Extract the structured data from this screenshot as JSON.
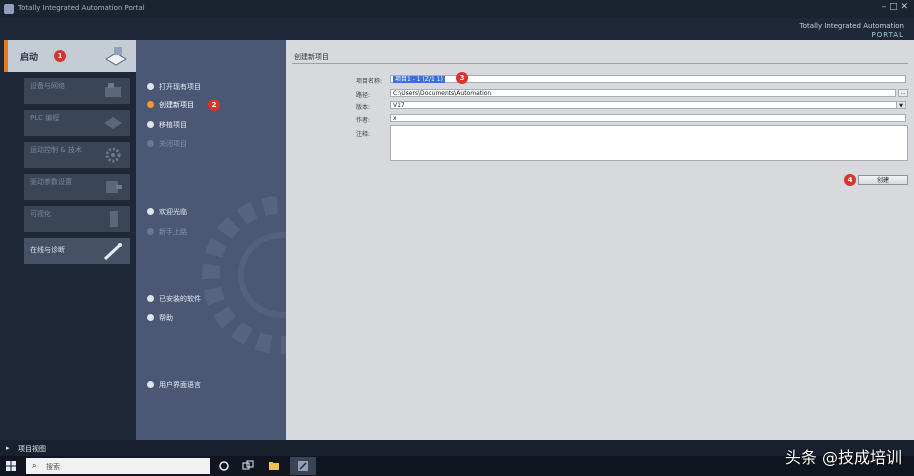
{
  "window": {
    "title": "Totally Integrated Automation Portal",
    "brand_line1": "Totally Integrated Automation",
    "brand_line2": "PORTAL",
    "controls": "–  □  ✕"
  },
  "left_panel": {
    "start_label": "启动",
    "start_badge": "1",
    "items": [
      {
        "label": "设备与网络",
        "icon": "network-devices-icon"
      },
      {
        "label": "PLC 编程",
        "icon": "plc-programming-icon"
      },
      {
        "label": "运动控制 & 技术",
        "icon": "motion-gear-icon"
      },
      {
        "label": "驱动参数设置",
        "icon": "drive-icon"
      },
      {
        "label": "可视化",
        "icon": "visualization-icon"
      },
      {
        "label": "在线与诊断",
        "icon": "online-diagnostics-icon"
      }
    ],
    "project_view": "项目视图"
  },
  "mid_menu": {
    "items": [
      {
        "label": "打开现有项目",
        "state": "normal"
      },
      {
        "label": "创建新项目",
        "state": "selected",
        "badge": "2"
      },
      {
        "label": "移植项目",
        "state": "normal"
      },
      {
        "label": "关闭项目",
        "state": "dim"
      },
      {
        "label": "欢迎光临",
        "state": "normal"
      },
      {
        "label": "新手上路",
        "state": "dim"
      },
      {
        "label": "已安装的软件",
        "state": "normal"
      },
      {
        "label": "帮助",
        "state": "normal"
      },
      {
        "label": "用户界面语言",
        "state": "normal"
      }
    ]
  },
  "form": {
    "heading": "创建新项目",
    "project_name_label": "项目名称:",
    "project_name_value": "项目1 - 1 (Z/1 1)",
    "project_name_badge": "3",
    "path_label": "路径:",
    "path_value": "C:\\Users\\Documents\\Automation",
    "version_label": "版本:",
    "version_value": "V17",
    "author_label": "作者:",
    "author_value": "x",
    "comment_label": "注释:",
    "comment_value": "",
    "create_button": "创建",
    "create_badge": "4"
  },
  "taskbar": {
    "search_placeholder": "搜索",
    "tray_time": "",
    "tray_date": ""
  },
  "watermark": "头条 @技成培训",
  "colors": {
    "accent_orange": "#e07b24",
    "badge_red": "#d9342b",
    "menu_bg": "#4a5876",
    "content_bg": "#d7d9dc"
  }
}
